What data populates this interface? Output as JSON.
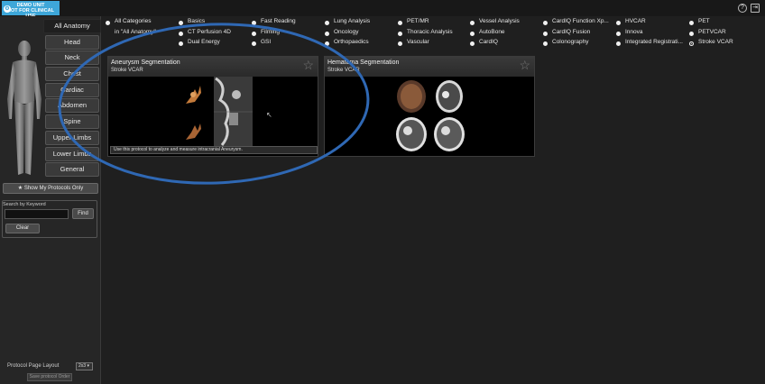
{
  "topbar": {
    "demo_line1": "DEMO UNIT",
    "demo_line2": "NOT FOR CLINICAL USE",
    "help_icon": "?",
    "exit_icon": "⇥"
  },
  "sidebar": {
    "tabs": [
      {
        "label": "All Anatomy",
        "active": true
      },
      {
        "label": "Head"
      },
      {
        "label": "Neck"
      },
      {
        "label": "Chest"
      },
      {
        "label": "Cardiac"
      },
      {
        "label": "Abdomen"
      },
      {
        "label": "Spine"
      },
      {
        "label": "Upper Limbs"
      },
      {
        "label": "Lower Limbs"
      },
      {
        "label": "General"
      }
    ],
    "show_my_protocols": "Show My Protocols Only",
    "search_label": "Search by Keyword",
    "find_button": "Find",
    "clear_button": "Clear",
    "layout_label": "Protocol Page Layout",
    "layout_value": "2x3",
    "save_order": "Save protocol Order"
  },
  "categories": [
    {
      "label": "All Categories",
      "sub": "in \"All Anatomy\""
    },
    {
      "label": "Basics"
    },
    {
      "label": "Fast Reading"
    },
    {
      "label": "Lung Analysis"
    },
    {
      "label": "PET/MR"
    },
    {
      "label": "Vessel Analysis"
    },
    {
      "label": "CardIQ Function Xp..."
    },
    {
      "label": "HVCAR"
    },
    {
      "label": "PET"
    },
    {
      "label": "CT Perfusion 4D"
    },
    {
      "label": "Filming"
    },
    {
      "label": "Oncology"
    },
    {
      "label": "Thoracic Analysis"
    },
    {
      "label": "AutoBone"
    },
    {
      "label": "CardIQ Fusion"
    },
    {
      "label": "Innova"
    },
    {
      "label": "PETVCAR"
    },
    {
      "label": "Dual Energy"
    },
    {
      "label": "GSI"
    },
    {
      "label": "Orthopaedics"
    },
    {
      "label": "Vascular"
    },
    {
      "label": "CardIQ"
    },
    {
      "label": "Colonography"
    },
    {
      "label": "Integrated Registrati..."
    },
    {
      "label": "Stroke VCAR",
      "selected": true
    }
  ],
  "cards": [
    {
      "title": "Aneurysm Segmentation",
      "subtitle": "Stroke VCAR",
      "description": "Use this protocol to analyze and measure intracranial Aneurysm."
    },
    {
      "title": "Hematoma Segmentation",
      "subtitle": "Stroke VCAR",
      "description": ""
    }
  ],
  "colors": {
    "annotation_ellipse": "#2f68b4",
    "demo_badge": "#3ea7d9"
  }
}
